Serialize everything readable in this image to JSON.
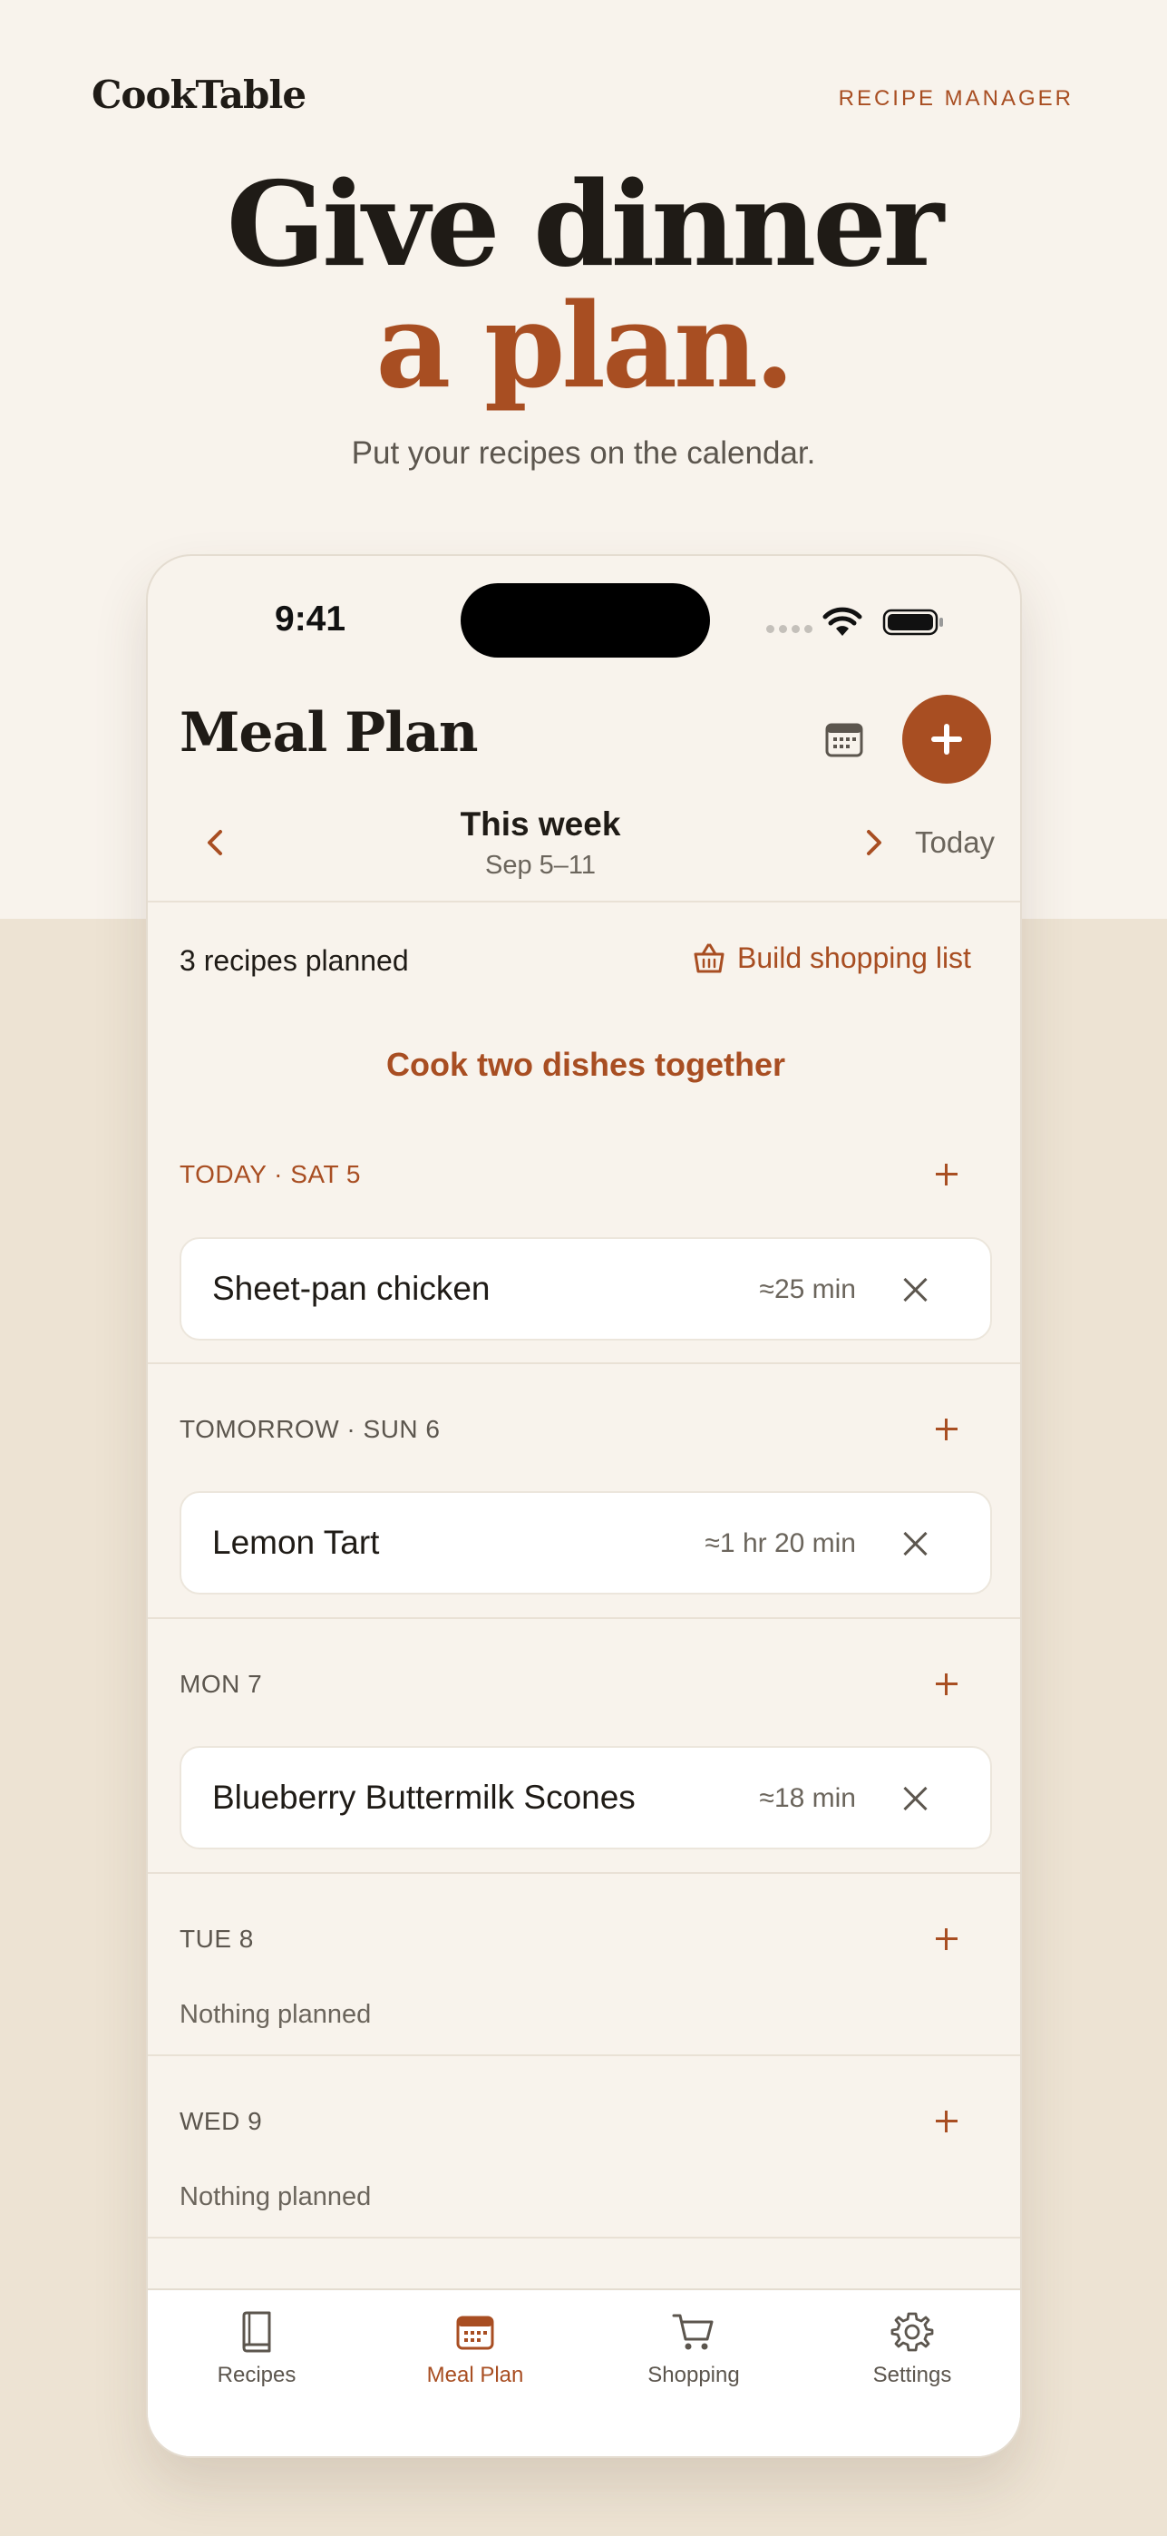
{
  "header": {
    "brand": "CookTable",
    "tag": "RECIPE MANAGER",
    "hero_line1": "Give dinner",
    "hero_line2": "a plan.",
    "subtitle": "Put your recipes on the calendar."
  },
  "status_bar": {
    "time": "9:41"
  },
  "app": {
    "title": "Meal Plan",
    "week": {
      "title": "This week",
      "range": "Sep 5–11",
      "today_label": "Today"
    },
    "summary": {
      "planned": "3 recipes planned",
      "shopping_link": "Build shopping list"
    },
    "cook_together": "Cook two dishes together",
    "days": [
      {
        "label": "TODAY · SAT 5",
        "is_today": true,
        "recipes": [
          {
            "name": "Sheet-pan chicken",
            "time": "≈25 min"
          }
        ]
      },
      {
        "label": "TOMORROW · SUN 6",
        "is_today": false,
        "recipes": [
          {
            "name": "Lemon Tart",
            "time": "≈1 hr 20 min"
          }
        ]
      },
      {
        "label": "MON 7",
        "is_today": false,
        "recipes": [
          {
            "name": "Blueberry Buttermilk Scones",
            "time": "≈18 min"
          }
        ]
      },
      {
        "label": "TUE 8",
        "is_today": false,
        "empty_text": "Nothing planned"
      },
      {
        "label": "WED 9",
        "is_today": false,
        "empty_text": "Nothing planned"
      }
    ],
    "tabs": [
      {
        "label": "Recipes",
        "icon": "book-icon",
        "active": false
      },
      {
        "label": "Meal Plan",
        "icon": "calendar-icon",
        "active": true
      },
      {
        "label": "Shopping",
        "icon": "cart-icon",
        "active": false
      },
      {
        "label": "Settings",
        "icon": "gear-icon",
        "active": false
      }
    ]
  },
  "colors": {
    "accent": "#A84E22",
    "background_top": "#F8F3EC",
    "background_bottom": "#EDE3D3",
    "text": "#1F1B16"
  }
}
